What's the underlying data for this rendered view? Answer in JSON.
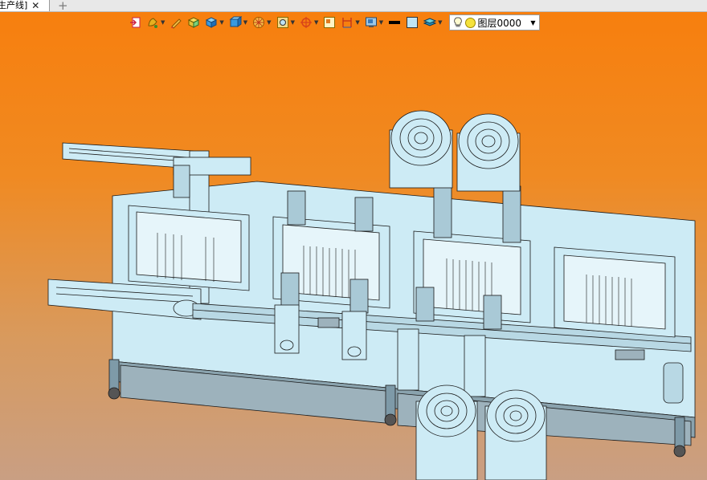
{
  "tabs": {
    "active_label": "生产线]",
    "close_glyph": "✕",
    "new_glyph": "+"
  },
  "toolbar": {
    "items": [
      "exit-sketch-icon",
      "paint-icon",
      "pencil-icon",
      "box-yellow-icon",
      "cube-blue-icon",
      "cube-front-icon",
      "render-wheel-icon",
      "zoom-fit-icon",
      "orient-icon",
      "window-icon",
      "dimension-icon",
      "display-settings-icon",
      "line-style-icon",
      "color-square-icon",
      "layer-stack-icon"
    ],
    "layer": {
      "value": "图层0000"
    }
  },
  "colors": {
    "bg_top": "#f77f0e",
    "bg_bottom": "#c99f83",
    "model_fill": "#cdebf5",
    "model_stroke": "#1a1a1a",
    "leg_fill": "#7e9aa8"
  }
}
